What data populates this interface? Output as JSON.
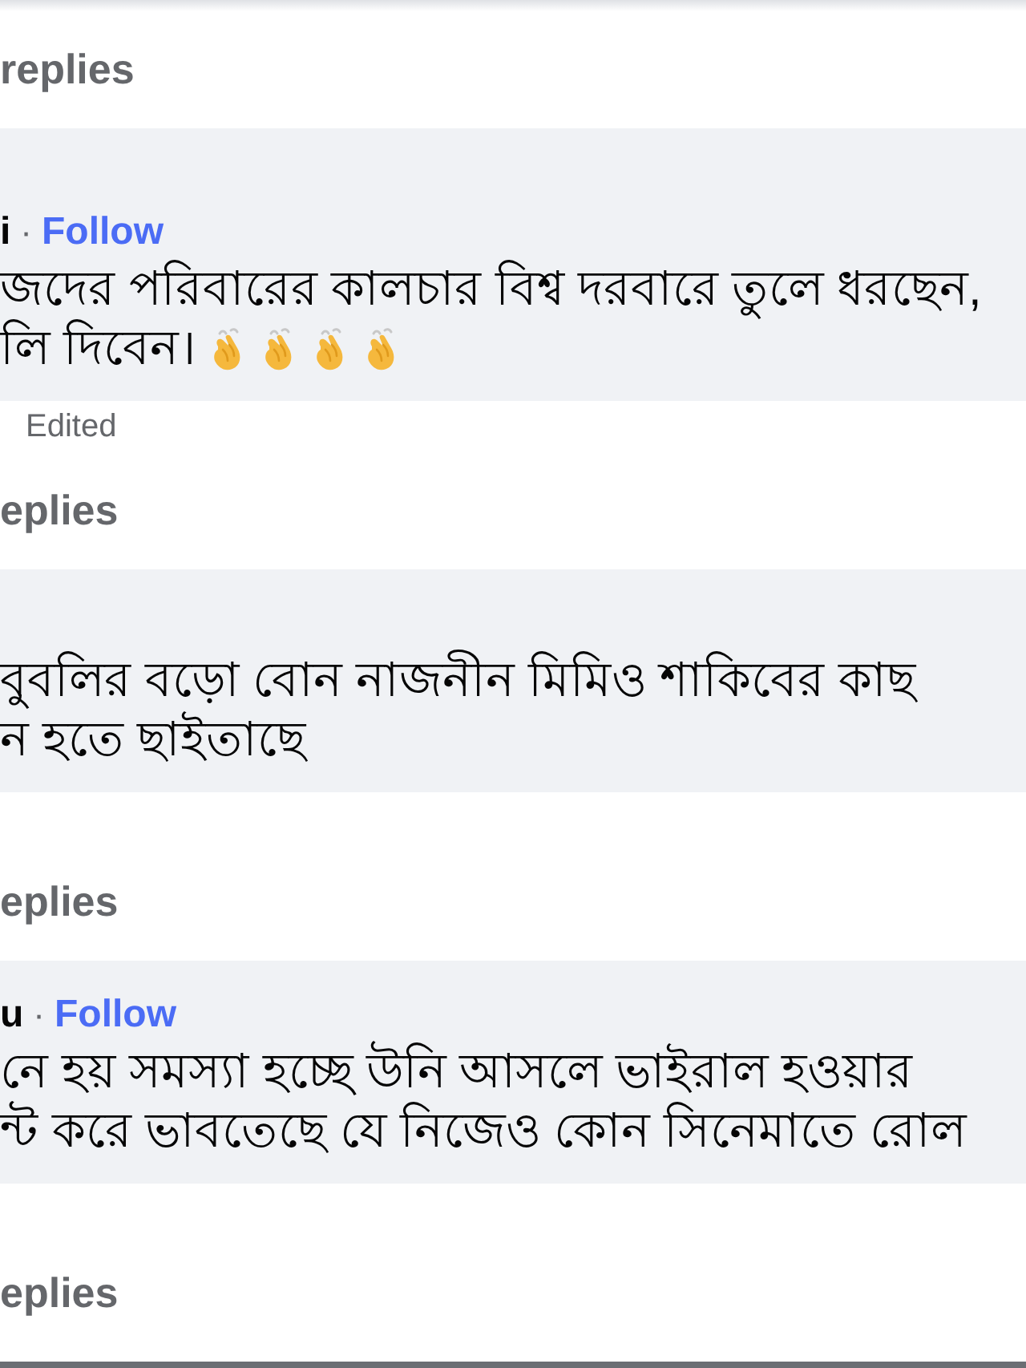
{
  "top_replies": {
    "label": "replies"
  },
  "comments": [
    {
      "author": "i",
      "separator": "·",
      "follow": "Follow",
      "lines": [
        "জদের পরিবারের কালচার বিশ্ব দরবারে তুলে ধরছেন,",
        "লি দিবেন।"
      ],
      "has_emoji": true,
      "meta": "Edited",
      "replies": "eplies"
    },
    {
      "lines": [
        "বুবলির বড়ো বোন নাজনীন মিমিও শাকিবের কাছ",
        "ন হতে ছাইতাছে"
      ],
      "has_emoji": false,
      "replies": "eplies"
    },
    {
      "author": "u",
      "separator": "·",
      "follow": "Follow",
      "lines": [
        "নে হয় সমস্যা হচ্ছে উনি আসলে ভাইরাল হওয়ার",
        "ন্ট করে ভাবতেছে যে নিজেও কোন সিনেমাতে রোল"
      ],
      "has_emoji": false,
      "replies": "eplies"
    }
  ]
}
